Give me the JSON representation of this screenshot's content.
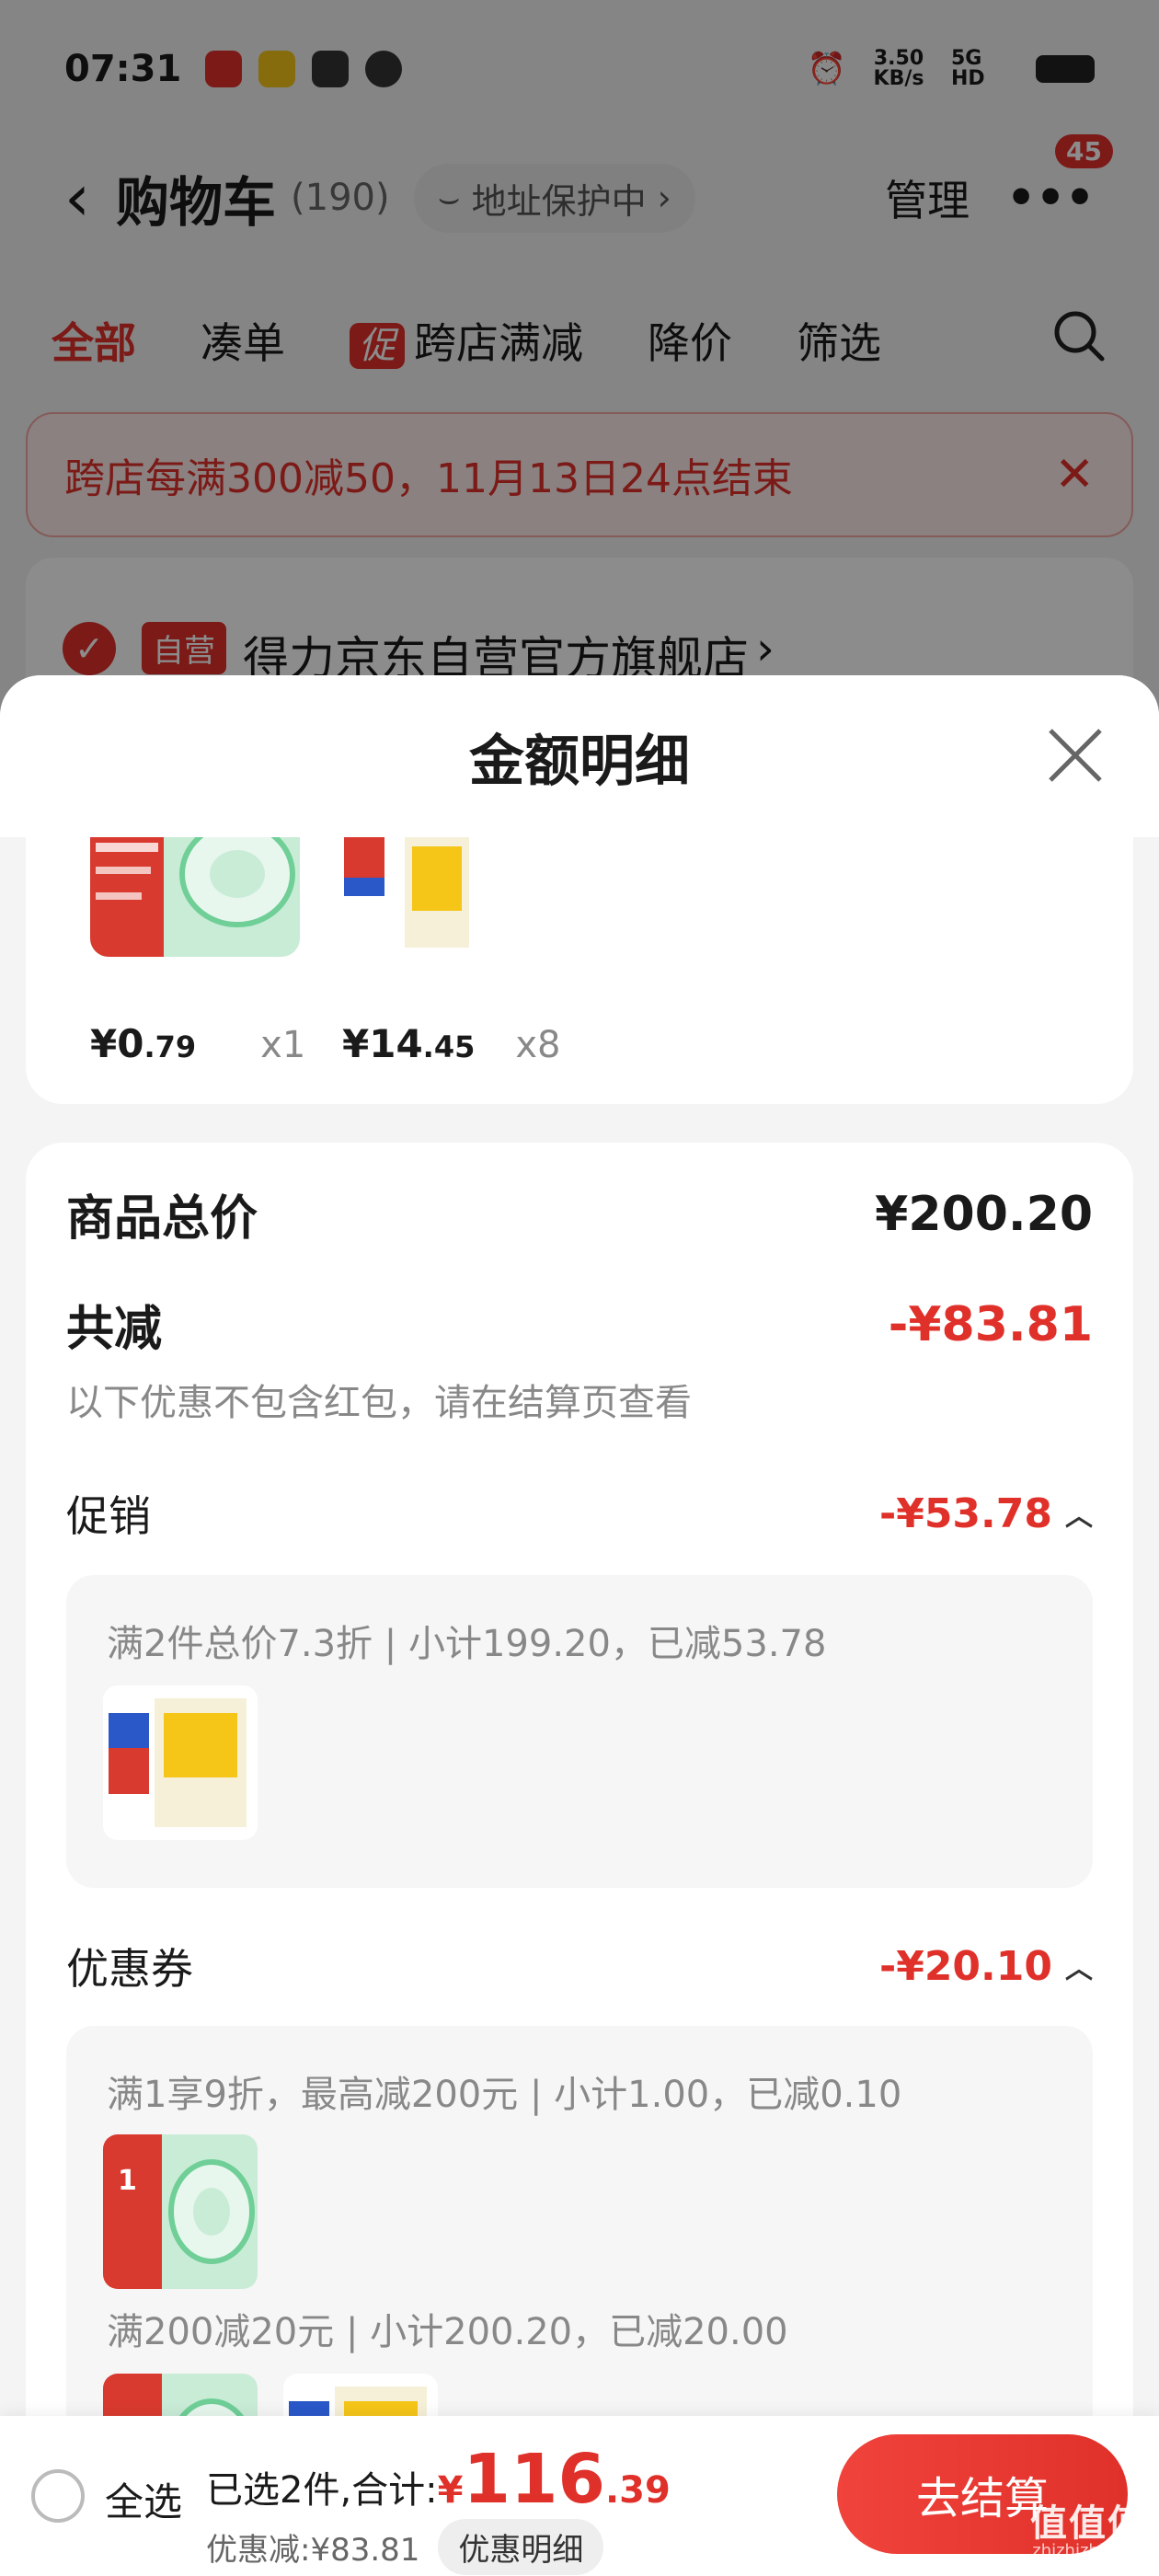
{
  "status_bar": {
    "time": "07:31",
    "speed": "3.50 KB/s",
    "network": "5G HD"
  },
  "header": {
    "title": "购物车",
    "count": "(190)",
    "address_chip": "地址保护中",
    "manage": "管理",
    "more_badge": "45"
  },
  "tabs": [
    "全部",
    "凑单",
    "跨店满减",
    "降价",
    "筛选"
  ],
  "promo_mark": "促",
  "banner": {
    "text": "跨店每满300减50，11月13日24点结束"
  },
  "store": {
    "self_tag": "自营",
    "name": "得力京东自营官方旗舰店"
  },
  "sheet": {
    "title": "金额明细",
    "items": [
      {
        "price_int": "¥0",
        "price_dec": ".79",
        "qty": "x1"
      },
      {
        "price_int": "¥14",
        "price_dec": ".45",
        "qty": "x8"
      }
    ],
    "goods_total_label": "商品总价",
    "goods_total_value": "¥200.20",
    "reduction_label": "共减",
    "reduction_value": "-¥83.81",
    "reduction_note": "以下优惠不包含红包，请在结算页查看",
    "promotion_label": "促销",
    "promotion_value": "-¥53.78",
    "promotion_line": "满2件总价7.3折 | 小计199.20，已减53.78",
    "coupon_label": "优惠券",
    "coupon_value": "-¥20.10",
    "coupon_line_1": "满1享9折，最高减200元 | 小计1.00，已减0.10",
    "coupon_line_2": "满200减20元 | 小计200.20，已减20.00"
  },
  "bottom_bar": {
    "select_all": "全选",
    "selected_text": "已选2件,合计:",
    "total_symbol": "¥",
    "total_int": "116",
    "total_dec": ".39",
    "discount_text": "优惠减:¥83.81",
    "detail_chip": "优惠明细",
    "checkout": "去结算"
  },
  "watermark": {
    "main": "值值值",
    "sub": "zhizhizhi.com"
  },
  "colors": {
    "accent": "#e0302a"
  }
}
